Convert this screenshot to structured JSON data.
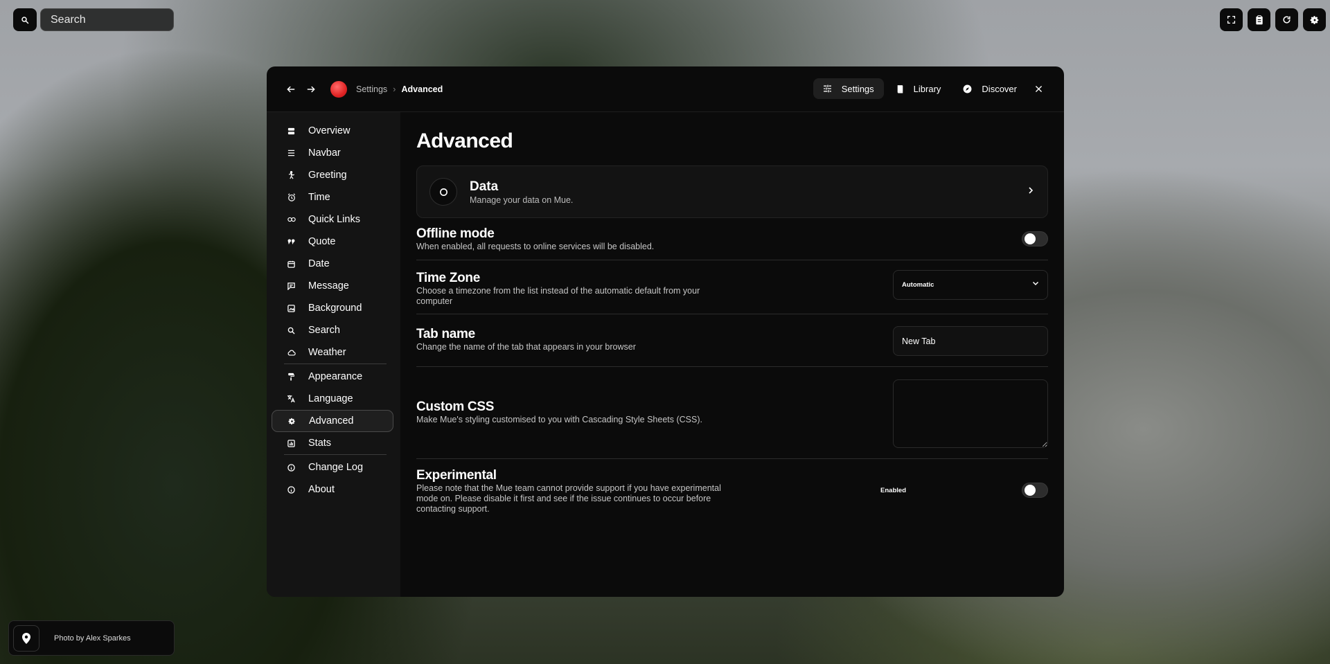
{
  "search": {
    "placeholder": "Search"
  },
  "topbar": {
    "icons": [
      "fullscreen-icon",
      "clipboard-icon",
      "refresh-icon",
      "gear-icon"
    ]
  },
  "breadcrumb": {
    "root": "Settings",
    "current": "Advanced"
  },
  "header_tabs": [
    {
      "label": "Settings",
      "icon": "sliders-icon",
      "active": true
    },
    {
      "label": "Library",
      "icon": "book-icon",
      "active": false
    },
    {
      "label": "Discover",
      "icon": "compass-icon",
      "active": false
    }
  ],
  "sidebar": {
    "items": [
      {
        "label": "Overview",
        "icon": "overview-icon"
      },
      {
        "label": "Navbar",
        "icon": "menu-icon"
      },
      {
        "label": "Greeting",
        "icon": "wave-icon"
      },
      {
        "label": "Time",
        "icon": "alarm-icon"
      },
      {
        "label": "Quick Links",
        "icon": "link-icon"
      },
      {
        "label": "Quote",
        "icon": "quote-icon"
      },
      {
        "label": "Date",
        "icon": "calendar-icon"
      },
      {
        "label": "Message",
        "icon": "message-icon"
      },
      {
        "label": "Background",
        "icon": "image-icon"
      },
      {
        "label": "Search",
        "icon": "search-icon"
      },
      {
        "label": "Weather",
        "icon": "cloud-icon"
      },
      {
        "label": "Appearance",
        "icon": "paint-roller-icon"
      },
      {
        "label": "Language",
        "icon": "translate-icon"
      },
      {
        "label": "Advanced",
        "icon": "gear-icon",
        "active": true
      },
      {
        "label": "Stats",
        "icon": "chart-icon"
      },
      {
        "label": "Change Log",
        "icon": "info-icon"
      },
      {
        "label": "About",
        "icon": "info-icon"
      }
    ]
  },
  "page": {
    "title": "Advanced",
    "data_card": {
      "title": "Data",
      "subtitle": "Manage your data on Mue."
    },
    "offline_mode": {
      "title": "Offline mode",
      "desc": "When enabled, all requests to online services will be disabled.",
      "enabled": false
    },
    "timezone": {
      "title": "Time Zone",
      "desc": "Choose a timezone from the list instead of the automatic default from your computer",
      "selected": "Automatic"
    },
    "tab_name": {
      "title": "Tab name",
      "desc": "Change the name of the tab that appears in your browser",
      "value": "New Tab"
    },
    "custom_css": {
      "title": "Custom CSS",
      "desc": "Make Mue's styling customised to you with Cascading Style Sheets (CSS).",
      "value": ""
    },
    "experimental": {
      "title": "Experimental",
      "desc": "Please note that the Mue team cannot provide support if you have experimental mode on. Please disable it first and see if the issue continues to occur before contacting support.",
      "label": "Enabled",
      "enabled": false
    }
  },
  "photo_credit": {
    "text": "Photo by Alex Sparkes"
  }
}
